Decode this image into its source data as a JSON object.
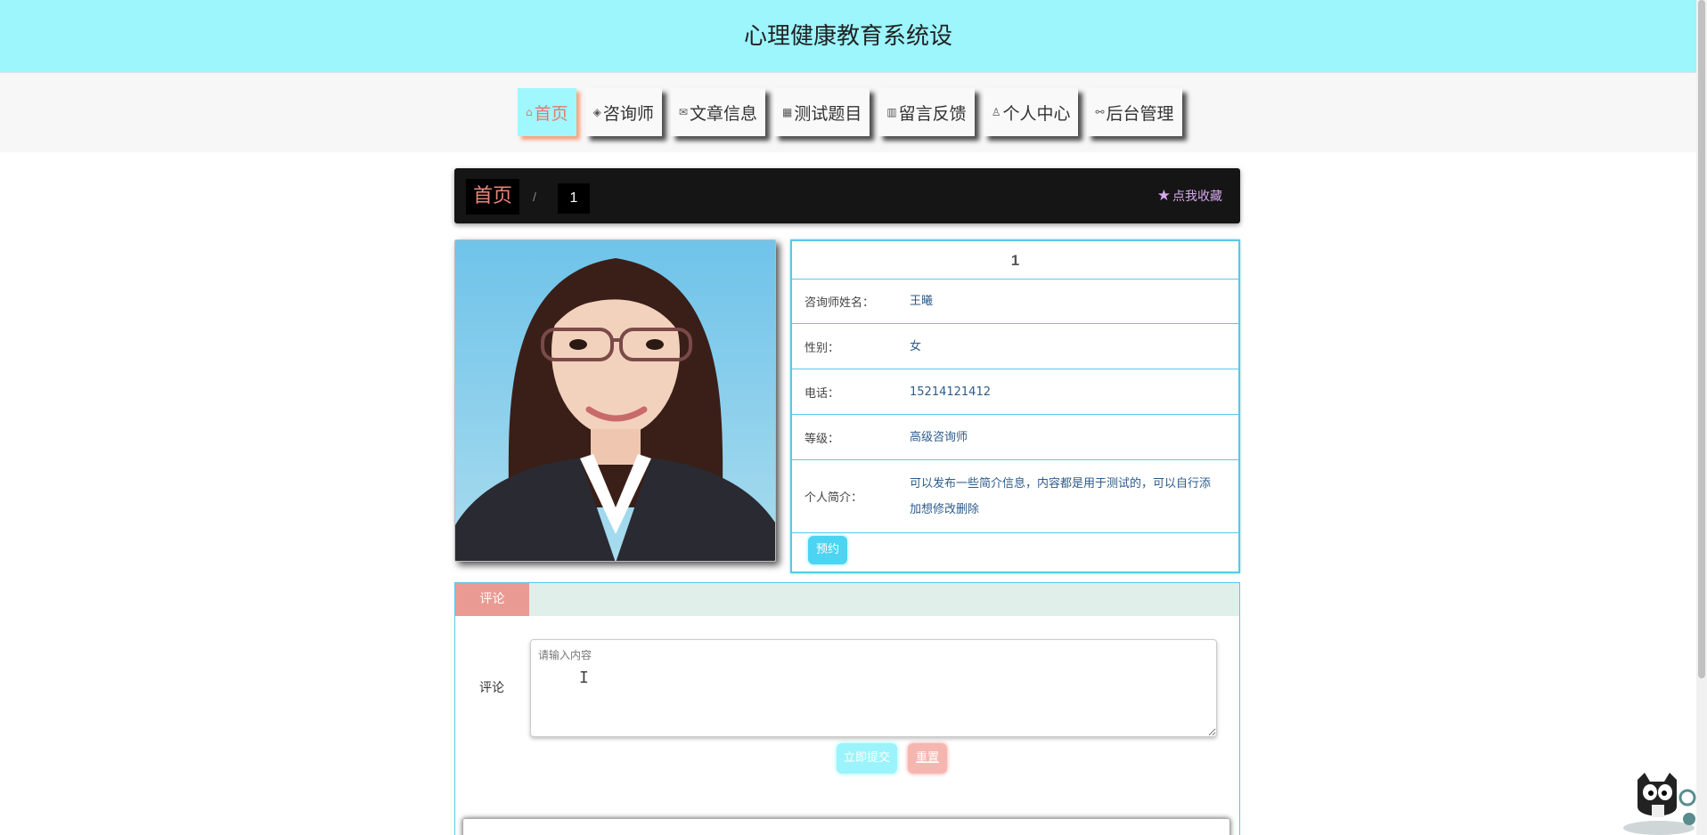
{
  "site": {
    "title": "心理健康教育系统设"
  },
  "nav": {
    "items": [
      {
        "label": "首页",
        "icon": "home-icon",
        "glyph": "⌂"
      },
      {
        "label": "咨询师",
        "icon": "layers-icon",
        "glyph": "◈"
      },
      {
        "label": "文章信息",
        "icon": "mail-icon",
        "glyph": "✉"
      },
      {
        "label": "测试题目",
        "icon": "calendar-icon",
        "glyph": "▦"
      },
      {
        "label": "留言反馈",
        "icon": "gift-icon",
        "glyph": "▥"
      },
      {
        "label": "个人中心",
        "icon": "user-icon",
        "glyph": "♙"
      },
      {
        "label": "后台管理",
        "icon": "link-icon",
        "glyph": "⚯"
      }
    ],
    "active_index": 0
  },
  "breadcrumb": {
    "home": "首页",
    "separator": "/",
    "current": "1",
    "favorite": "点我收藏"
  },
  "detail": {
    "title": "1",
    "rows": [
      {
        "label": "咨询师姓名：",
        "value": "王曦"
      },
      {
        "label": "性别：",
        "value": "女"
      },
      {
        "label": "电话：",
        "value": "15214121412"
      },
      {
        "label": "等级：",
        "value": "高级咨询师"
      },
      {
        "label": "个人简介：",
        "value": "可以发布一些简介信息，内容都是用于测试的，可以自行添加想修改删除"
      }
    ],
    "book_button": "预约"
  },
  "comment": {
    "tab": "评论",
    "label": "评论",
    "placeholder": "请输入内容",
    "submit": "立即提交",
    "reset": "重置"
  },
  "colors": {
    "header_bg": "#9cf6fc",
    "accent_cyan": "#5ac8e6",
    "accent_salmon": "#e99b93",
    "breadcrumb_bg": "#151515"
  }
}
